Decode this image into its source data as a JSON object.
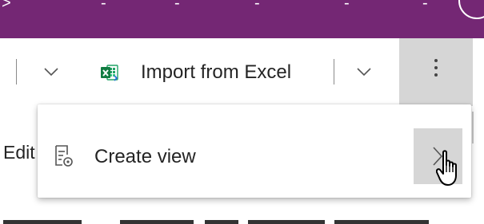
{
  "app_bar": {
    "background_color": "#742774",
    "glyphs": [
      ">",
      "-",
      "-",
      "-",
      "-",
      "-"
    ]
  },
  "command_bar": {
    "dropdown_icon": "chevron-down-icon",
    "import_button": {
      "icon": "excel-icon",
      "label": "Import from Excel"
    },
    "import_dropdown_icon": "chevron-down-icon",
    "more_button_icon": "more-vertical-icon"
  },
  "page": {
    "edit_label": "Edit"
  },
  "flyout": {
    "items": [
      {
        "icon": "view-document-icon",
        "label": "Create view",
        "submenu_icon": "chevron-right-icon"
      }
    ]
  },
  "cursor": "hand-pointer-icon"
}
